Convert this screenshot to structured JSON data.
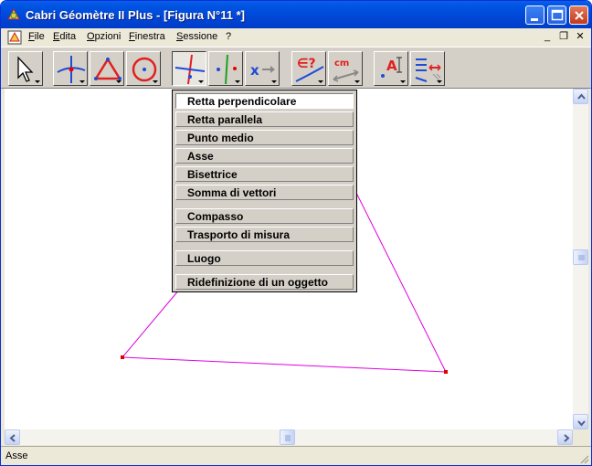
{
  "window": {
    "title": "Cabri Géomètre II Plus - [Figura N°11 *]"
  },
  "menu": {
    "items": [
      {
        "label": "File"
      },
      {
        "label": "Edita"
      },
      {
        "label": "Opzioni"
      },
      {
        "label": "Finestra"
      },
      {
        "label": "Sessione"
      },
      {
        "label": "?"
      }
    ],
    "mdi": {
      "minimize": "_",
      "restore": "❐",
      "close": "✕"
    }
  },
  "toolbar": {
    "tools": [
      {
        "icon": "pointer-arrow-icon"
      },
      {
        "icon": "points-icon"
      },
      {
        "icon": "triangle-icon"
      },
      {
        "icon": "circle-icon"
      },
      {
        "icon": "construct-perpendicular-icon",
        "pressed": true
      },
      {
        "icon": "transform-icon"
      },
      {
        "icon": "macro-icon"
      },
      {
        "icon": "check-property-icon"
      },
      {
        "icon": "measure-icon"
      },
      {
        "icon": "display-label-icon"
      },
      {
        "icon": "drawing-attributes-icon"
      }
    ]
  },
  "dropdown": {
    "items": [
      {
        "label": "Retta perpendicolare",
        "active": true
      },
      {
        "label": "Retta parallela"
      },
      {
        "label": "Punto medio"
      },
      {
        "label": "Asse"
      },
      {
        "label": "Bisettrice"
      },
      {
        "label": "Somma di vettori"
      },
      {
        "label": "Compasso"
      },
      {
        "label": "Trasporto di misura"
      },
      {
        "label": "Luogo"
      },
      {
        "label": "Ridefinizione di un oggetto"
      }
    ]
  },
  "figure": {
    "line_color": "#e000e0",
    "point_color": "#e00000"
  },
  "status": {
    "text": "Asse"
  }
}
